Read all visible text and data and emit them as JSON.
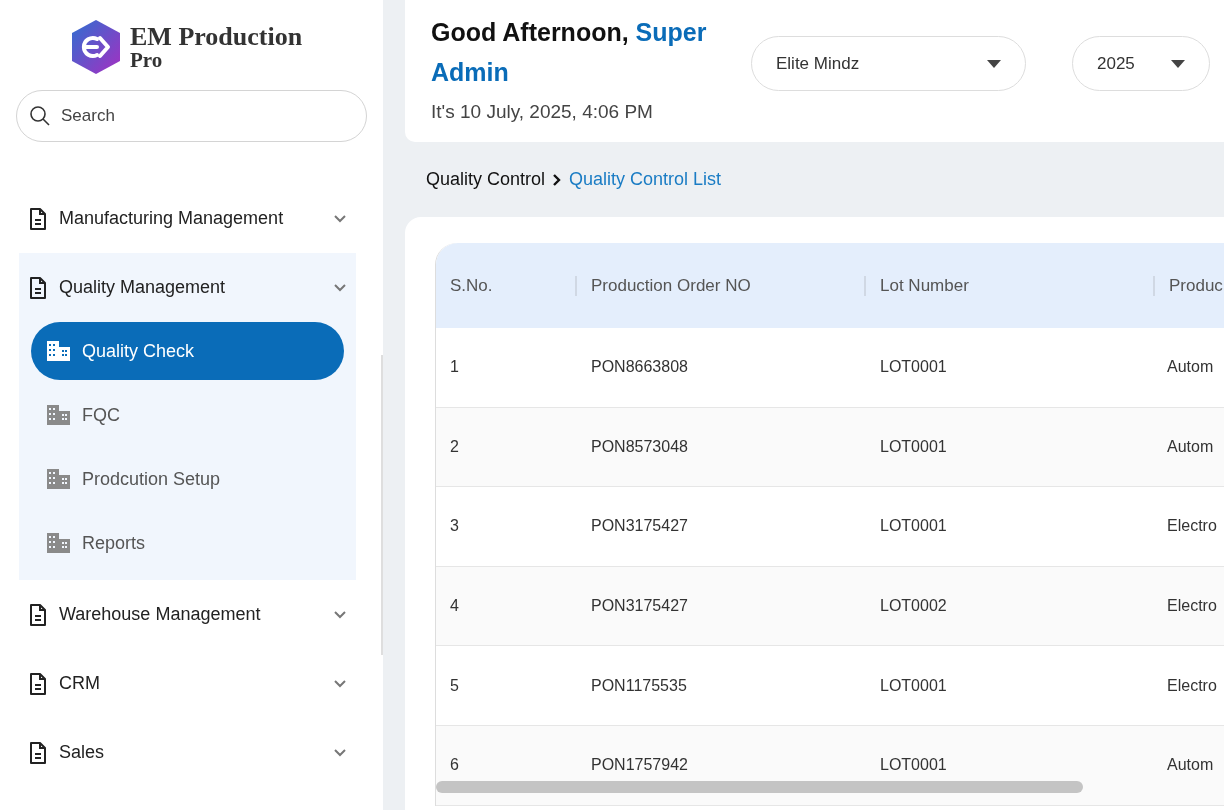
{
  "brand": {
    "name": "EM Production",
    "edition": "Pro"
  },
  "search": {
    "placeholder": "Search"
  },
  "nav": [
    {
      "label": "Manufacturing Management",
      "expanded": false
    },
    {
      "label": "Quality Management",
      "expanded": true,
      "children": [
        {
          "label": "Quality Check",
          "selected": true
        },
        {
          "label": "FQC",
          "selected": false
        },
        {
          "label": "Prodcution Setup",
          "selected": false
        },
        {
          "label": "Reports",
          "selected": false
        }
      ]
    },
    {
      "label": "Warehouse Management",
      "expanded": false
    },
    {
      "label": "CRM",
      "expanded": false
    },
    {
      "label": "Sales",
      "expanded": false
    }
  ],
  "header": {
    "greeting": "Good Afternoon,",
    "user": "Super Admin",
    "date": "It's 10 July, 2025, 4:06 PM",
    "company": "Elite Mindz",
    "year": "2025"
  },
  "breadcrumb": [
    "Quality Control",
    "Quality Control List"
  ],
  "table": {
    "columns": [
      "S.No.",
      "Production Order NO",
      "Lot Number",
      "Produc"
    ],
    "rows": [
      [
        "1",
        "PON8663808",
        "LOT0001",
        "Autom"
      ],
      [
        "2",
        "PON8573048",
        "LOT0001",
        "Autom"
      ],
      [
        "3",
        "PON3175427",
        "LOT0001",
        "Electro"
      ],
      [
        "4",
        "PON3175427",
        "LOT0002",
        "Electro"
      ],
      [
        "5",
        "PON1175535",
        "LOT0001",
        "Electro"
      ],
      [
        "6",
        "PON1757942",
        "LOT0001",
        "Autom"
      ]
    ]
  }
}
